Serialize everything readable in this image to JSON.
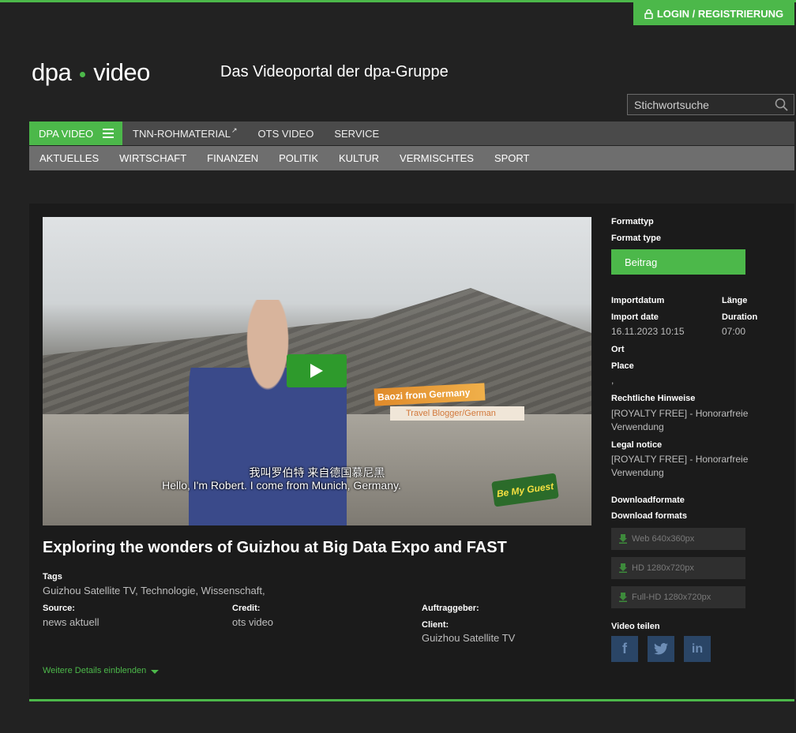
{
  "header": {
    "login_label": "LOGIN / REGISTRIERUNG",
    "logo_left": "dpa",
    "logo_right": "video",
    "tagline": "Das Videoportal der dpa-Gruppe",
    "search_placeholder": "Stichwortsuche"
  },
  "nav_primary": [
    {
      "label": "DPA VIDEO"
    },
    {
      "label": "TNN-ROHMATERIAL"
    },
    {
      "label": "OTS VIDEO"
    },
    {
      "label": "SERVICE"
    }
  ],
  "nav_secondary": [
    {
      "label": "AKTUELLES"
    },
    {
      "label": "WIRTSCHAFT"
    },
    {
      "label": "FINANZEN"
    },
    {
      "label": "POLITIK"
    },
    {
      "label": "KULTUR"
    },
    {
      "label": "VERMISCHTES"
    },
    {
      "label": "SPORT"
    }
  ],
  "video": {
    "lower_third_name": "Baozi from Germany",
    "lower_third_role": "Travel Blogger/German",
    "subtitle_cn": "我叫罗伯特 来自德国慕尼黑",
    "subtitle_en": "Hello, I'm Robert. I come from Munich, Germany.",
    "badge": "Be My Guest"
  },
  "article": {
    "title": "Exploring the wonders of Guizhou at Big Data Expo and FAST",
    "tags_label": "Tags",
    "tags_value": "Guizhou Satellite TV, Technologie, Wissenschaft,",
    "source_label": "Source:",
    "source_value": "news aktuell",
    "credit_label": "Credit:",
    "credit_value": "ots video",
    "auftraggeber_label": "Auftraggeber:",
    "client_label": "Client:",
    "client_value": "Guizhou Satellite TV",
    "details_link": "Weitere Details einblenden"
  },
  "sidebar": {
    "formattyp_de": "Formattyp",
    "formattyp_en": "Format type",
    "format_value": "Beitrag",
    "import_de": "Importdatum",
    "import_en": "Import date",
    "import_value": "16.11.2023 10:15",
    "laenge_de": "Länge",
    "laenge_en": "Duration",
    "duration_value": "07:00",
    "ort_de": "Ort",
    "place_en": "Place",
    "place_value": ",",
    "rechtliche_de": "Rechtliche Hinweise",
    "rechtliche_value": "[ROYALTY FREE] - Honorarfreie Verwendung",
    "legal_en": "Legal notice",
    "legal_value": "[ROYALTY FREE] - Honorarfreie Verwendung",
    "downloadformate_de": "Downloadformate",
    "downloadformats_en": "Download formats",
    "downloads": [
      {
        "label": "Web 640x360px"
      },
      {
        "label": "HD 1280x720px"
      },
      {
        "label": "Full-HD 1280x720px"
      }
    ],
    "share_label": "Video teilen",
    "share_buttons": [
      {
        "glyph": "f"
      },
      {
        "glyph": "t"
      },
      {
        "glyph": "in"
      }
    ]
  },
  "colors": {
    "accent": "#4cb84a",
    "background": "#222222",
    "share_button": "#2a4566"
  }
}
